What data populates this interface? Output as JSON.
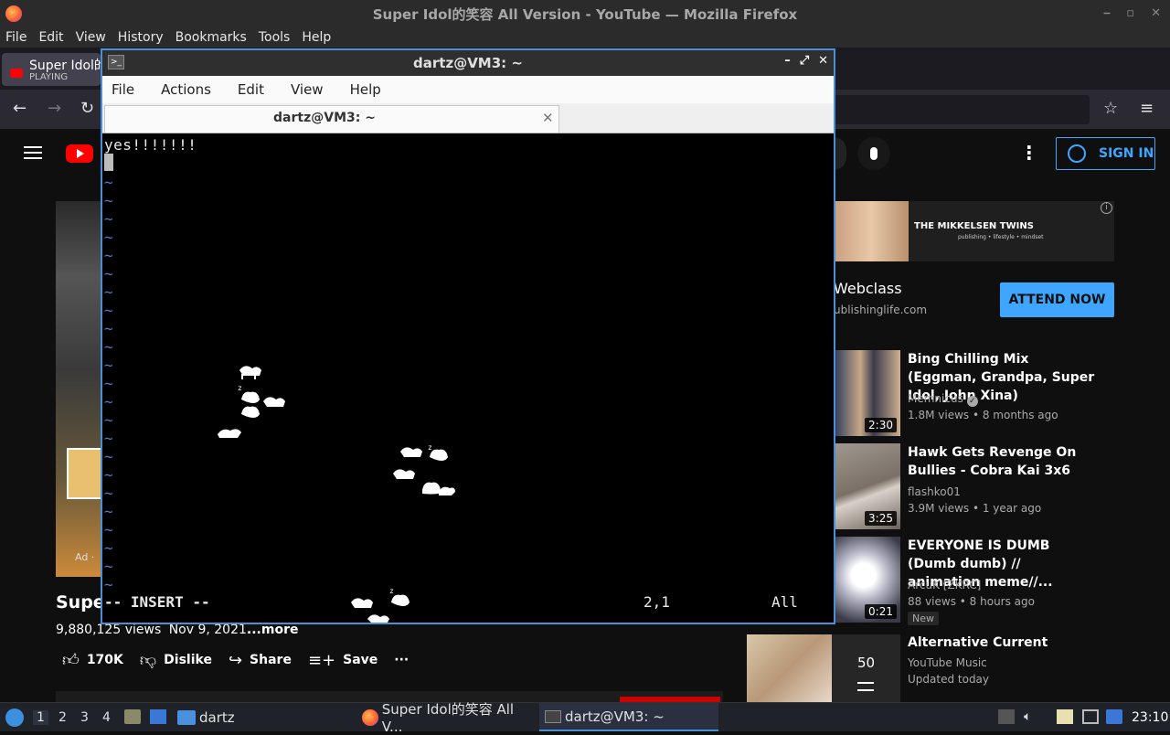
{
  "firefox": {
    "window_title": "Super Idol的笑容 All Version - YouTube — Mozilla Firefox",
    "menu": [
      "File",
      "Edit",
      "View",
      "History",
      "Bookmarks",
      "Tools",
      "Help"
    ],
    "tab": {
      "title": "Super Idol的",
      "status": "PLAYING"
    }
  },
  "youtube": {
    "sign_in": "SIGN IN",
    "video": {
      "title": "Super",
      "views": "9,880,125 views",
      "date": "Nov 9, 2021",
      "more": "...more",
      "ad_label": "Ad ·"
    },
    "actions": {
      "like": "170K",
      "dislike": "Dislike",
      "share": "Share",
      "save": "Save",
      "more": "···"
    },
    "ad": {
      "brand": "THE MIKKELSEN TWINS",
      "tagline": "publishing • lifestyle • mindset",
      "name": "Webclass",
      "url": "ublishinglife.com",
      "cta": "ATTEND NOW"
    },
    "recommendations": [
      {
        "title": "Bing Chilling Mix (Eggman, Grandpa, Super Idol, John Xina)",
        "channel": "Memnicus",
        "verified": true,
        "stats": "1.8M views • 8 months ago",
        "duration": "2:30",
        "thumb_color": "#3a4a6a"
      },
      {
        "title": "Hawk Gets Revenge On Bullies - Cobra Kai 3x6",
        "channel": "flashko01",
        "verified": false,
        "stats": "3.9M views • 1 year ago",
        "duration": "3:25",
        "thumb_color": "#8a8078"
      },
      {
        "title": "EVERYONE IS DUMB (Dumb dumb) // animation meme//...",
        "channel": "ArcuK [ZKRC]",
        "verified": false,
        "stats": "88 views • 8 hours ago",
        "duration": "0:21",
        "badge": "New",
        "thumb_color": "#d8d8e0"
      },
      {
        "title": "Alternative Current",
        "channel": "YouTube Music",
        "verified": false,
        "stats": "Updated today",
        "mix_count": "50",
        "thumb_color": "#c8b090"
      }
    ]
  },
  "terminal": {
    "title": "dartz@VM3: ~",
    "menu": [
      "File",
      "Actions",
      "Edit",
      "View",
      "Help"
    ],
    "tab_label": "dartz@VM3: ~",
    "line1": "yes!!!!!!!",
    "tilde": "~",
    "mode": "-- INSERT --",
    "position": "2,1",
    "scroll": "All"
  },
  "taskbar": {
    "workspaces": [
      "1",
      "2",
      "3",
      "4"
    ],
    "folder_label": "dartz",
    "tasks": [
      {
        "label": "Super Idol的笑容 All V..."
      },
      {
        "label": "dartz@VM3: ~"
      }
    ],
    "clock": "23:10"
  }
}
